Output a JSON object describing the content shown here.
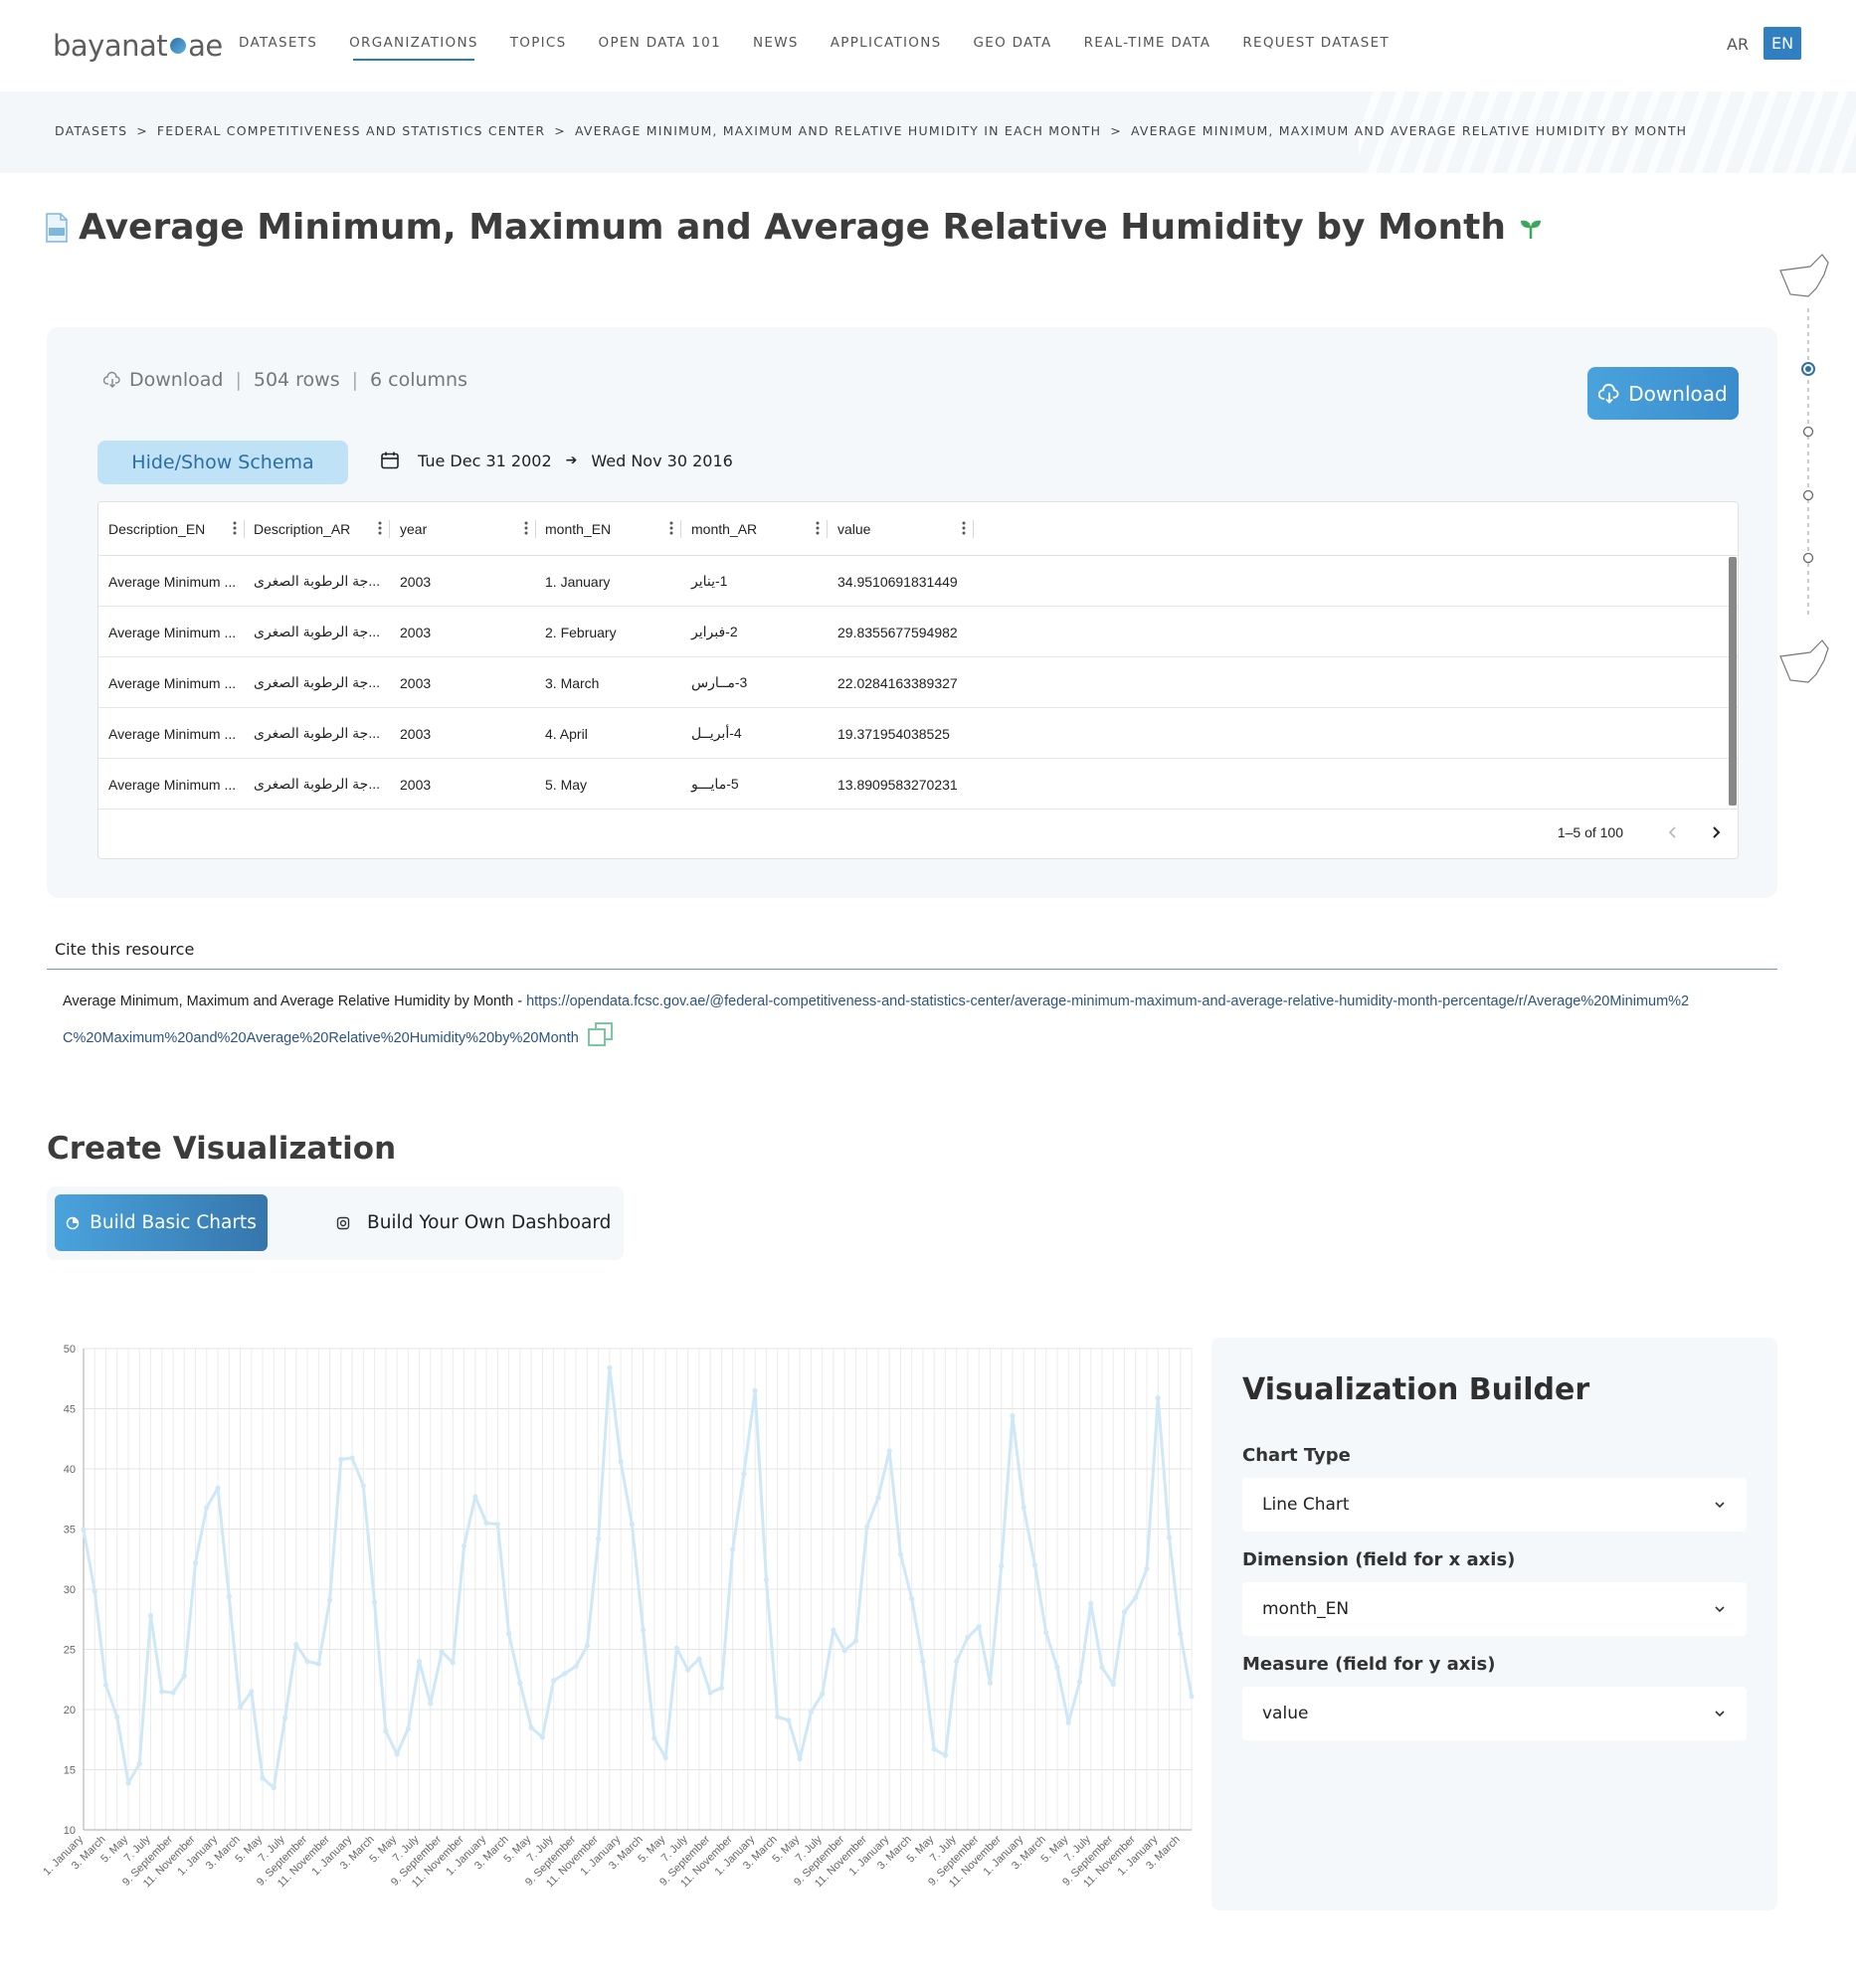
{
  "header": {
    "logo_text": "bayanat",
    "logo_suffix": "ae",
    "nav": [
      "DATASETS",
      "ORGANIZATIONS",
      "TOPICS",
      "OPEN DATA 101",
      "NEWS",
      "APPLICATIONS",
      "GEO DATA",
      "REAL-TIME DATA",
      "REQUEST DATASET"
    ],
    "active_nav": "ORGANIZATIONS",
    "lang_ar": "AR",
    "lang_en": "EN"
  },
  "breadcrumb": [
    "DATASETS",
    "FEDERAL COMPETITIVENESS AND STATISTICS CENTER",
    "AVERAGE MINIMUM, MAXIMUM AND RELATIVE HUMIDITY IN EACH MONTH",
    "AVERAGE MINIMUM, MAXIMUM AND AVERAGE RELATIVE HUMIDITY BY MONTH"
  ],
  "breadcrumb_sep": ">",
  "page": {
    "title": "Average Minimum, Maximum and Average Relative Humidity by Month"
  },
  "dataset": {
    "download_label": "Download",
    "rows": "504 rows",
    "columns": "6 columns",
    "download_button": "Download",
    "schema_button": "Hide/Show Schema",
    "date_from": "Tue Dec 31 2002",
    "date_to": "Wed Nov 30 2016"
  },
  "table": {
    "columns": [
      "Description_EN",
      "Description_AR",
      "year",
      "month_EN",
      "month_AR",
      "value"
    ],
    "rows": [
      [
        "Average Minimum ...",
        "...ﺟﺔ اﻟﺮﻃﻮﺑﺔ اﻟﺼﻐﺮى",
        "2003",
        "1. January",
        "1-ﻳﻨﺎﻳﺮ",
        "34.9510691831449"
      ],
      [
        "Average Minimum ...",
        "...ﺟﺔ اﻟﺮﻃﻮﺑﺔ اﻟﺼﻐﺮى",
        "2003",
        "2. February",
        "2-ﻓﺒﺮاﻳﺮ",
        "29.8355677594982"
      ],
      [
        "Average Minimum ...",
        "...ﺟﺔ اﻟﺮﻃﻮﺑﺔ اﻟﺼﻐﺮى",
        "2003",
        "3. March",
        "3-ﻣــﺎرس",
        "22.0284163389327"
      ],
      [
        "Average Minimum ...",
        "...ﺟﺔ اﻟﺮﻃﻮﺑﺔ اﻟﺼﻐﺮى",
        "2003",
        "4. April",
        "4-أﺑﺮﻳــﻞ",
        "19.371954038525"
      ],
      [
        "Average Minimum ...",
        "...ﺟﺔ اﻟﺮﻃﻮﺑﺔ اﻟﺼﻐﺮى",
        "2003",
        "5. May",
        "5-ﻣﺎﻳـــﻮ",
        "13.8909583270231"
      ]
    ],
    "pager_text": "1–5 of 100"
  },
  "cite": {
    "label": "Cite this resource",
    "text": "Average Minimum, Maximum and Average Relative Humidity by Month - ",
    "url": "https://opendata.fcsc.gov.ae/@federal-competitiveness-and-statistics-center/average-minimum-maximum-and-average-relative-humidity-month-percentage/r/Average%20Minimum%2C%20Maximum%20and%20Average%20Relative%20Humidity%20by%20Month"
  },
  "visualization": {
    "heading": "Create Visualization",
    "tab_basic": "Build Basic Charts",
    "tab_dashboard": "Build Your Own Dashboard"
  },
  "builder": {
    "title": "Visualization Builder",
    "chart_type_label": "Chart Type",
    "chart_type_value": "Line Chart",
    "dimension_label": "Dimension (field for x axis)",
    "dimension_value": "month_EN",
    "measure_label": "Measure (field for y axis)",
    "measure_value": "value"
  },
  "colors": {
    "accent": "#2f7fc1",
    "line": "#cfe8f7",
    "panel": "#f5f8fb"
  },
  "chart_data": {
    "type": "line",
    "x": [
      "1. January",
      "2. February",
      "3. March",
      "4. April",
      "5. May",
      "6. June",
      "7. July",
      "8. August",
      "9. September",
      "10. October",
      "11. November",
      "12. December",
      "1. January",
      "2. February",
      "3. March",
      "4. April",
      "5. May",
      "6. June",
      "7. July",
      "8. August",
      "9. September",
      "10. October",
      "11. November",
      "12. December",
      "1. January",
      "2. February",
      "3. March",
      "4. April",
      "5. May",
      "6. June",
      "7. July",
      "8. August",
      "9. September",
      "10. October",
      "11. November",
      "12. December",
      "1. January",
      "2. February",
      "3. March",
      "4. April",
      "5. May",
      "6. June",
      "7. July",
      "8. August",
      "9. September",
      "10. October",
      "11. November",
      "12. December",
      "1. January",
      "2. February",
      "3. March",
      "4. April",
      "5. May",
      "6. June",
      "7. July",
      "8. August",
      "9. September",
      "10. October",
      "11. November",
      "12. December",
      "1. January",
      "2. February",
      "3. March",
      "4. April",
      "5. May",
      "6. June",
      "7. July",
      "8. August",
      "9. September",
      "10. October",
      "11. November",
      "12. December",
      "1. January",
      "2. February",
      "3. March",
      "4. April",
      "5. May",
      "6. June",
      "7. July",
      "8. August",
      "9. September",
      "10. October",
      "11. November",
      "12. December",
      "1. January",
      "2. February",
      "3. March",
      "4. April",
      "5. May",
      "6. June",
      "7. July",
      "8. August",
      "9. September",
      "10. October",
      "11. November",
      "12. December",
      "1. January",
      "2. February",
      "3. March",
      "4. April"
    ],
    "tick_labels": [
      "1. January",
      "3. March",
      "5. May",
      "7. July",
      "9. September",
      "11. November"
    ],
    "values": [
      34.95,
      29.84,
      22.03,
      19.37,
      13.89,
      15.5,
      27.8,
      21.5,
      21.4,
      22.8,
      32.2,
      36.8,
      38.4,
      29.4,
      20.2,
      21.5,
      14.3,
      13.5,
      19.3,
      25.4,
      24.0,
      23.8,
      29.1,
      40.8,
      40.9,
      38.6,
      28.9,
      18.2,
      16.3,
      18.4,
      24.0,
      20.5,
      24.8,
      23.9,
      33.6,
      37.7,
      35.5,
      35.4,
      26.3,
      22.2,
      18.5,
      17.7,
      22.4,
      23.0,
      23.6,
      25.3,
      34.2,
      48.4,
      40.6,
      35.4,
      26.6,
      17.6,
      16.0,
      25.1,
      23.3,
      24.2,
      21.4,
      21.8,
      33.3,
      39.6,
      46.5,
      30.8,
      19.4,
      19.1,
      15.9,
      19.8,
      21.3,
      26.6,
      24.9,
      25.7,
      35.2,
      37.6,
      41.5,
      32.9,
      29.2,
      24.0,
      16.7,
      16.2,
      24.0,
      26.0,
      26.9,
      22.2,
      31.9,
      44.4,
      36.8,
      32.0,
      26.4,
      23.5,
      18.9,
      22.3,
      28.8,
      23.5,
      22.1,
      28.1,
      29.3,
      31.7,
      45.9,
      34.3,
      26.3,
      21.1
    ],
    "ylim": [
      10,
      50
    ],
    "yticks": [
      10,
      15,
      20,
      25,
      30,
      35,
      40,
      45,
      50
    ],
    "grid": true
  }
}
